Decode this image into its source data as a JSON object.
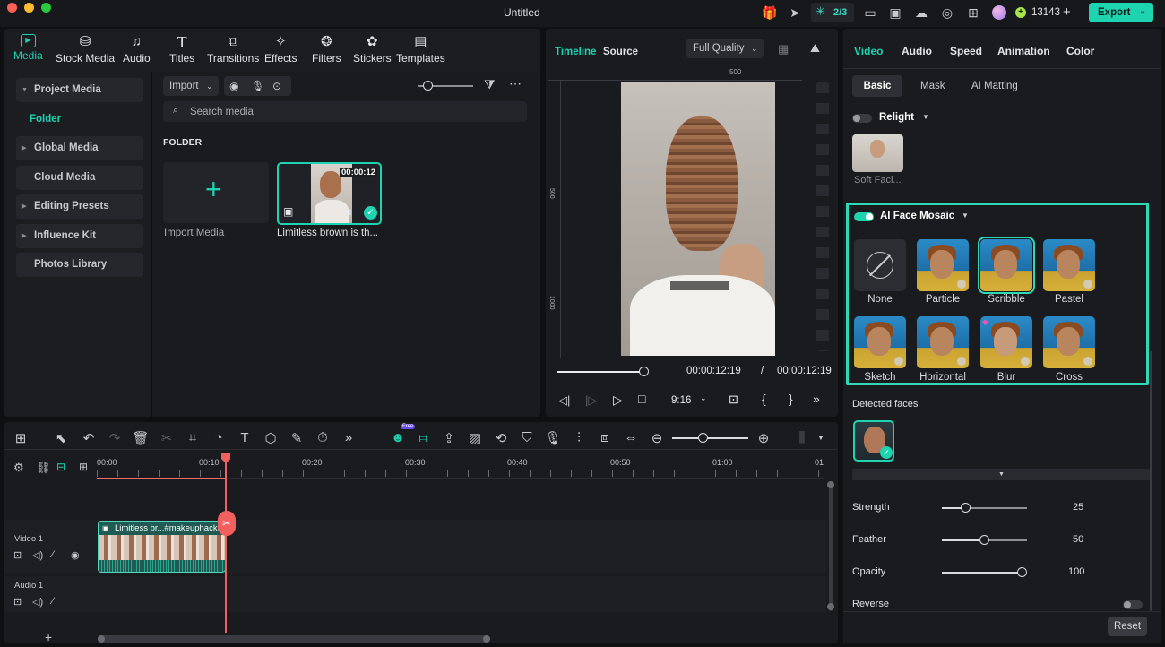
{
  "window": {
    "title": "Untitled",
    "render_progress": "2/3",
    "credits": "13143",
    "export_label": "Export"
  },
  "toolbar": [
    {
      "label": "Media",
      "icon": "media-icon"
    },
    {
      "label": "Stock Media",
      "icon": "stock-media-icon"
    },
    {
      "label": "Audio",
      "icon": "audio-icon"
    },
    {
      "label": "Titles",
      "icon": "titles-icon"
    },
    {
      "label": "Transitions",
      "icon": "transitions-icon"
    },
    {
      "label": "Effects",
      "icon": "effects-icon"
    },
    {
      "label": "Filters",
      "icon": "filters-icon"
    },
    {
      "label": "Stickers",
      "icon": "stickers-icon"
    },
    {
      "label": "Templates",
      "icon": "templates-icon"
    }
  ],
  "sidebar": {
    "items": [
      {
        "label": "Project Media"
      },
      {
        "label": "Folder"
      },
      {
        "label": "Global Media"
      },
      {
        "label": "Cloud Media"
      },
      {
        "label": "Editing Presets"
      },
      {
        "label": "Influence Kit"
      },
      {
        "label": "Photos Library"
      }
    ]
  },
  "media": {
    "import_label": "Import",
    "search_placeholder": "Search media",
    "folder_heading": "FOLDER",
    "import_tile_label": "Import Media",
    "clip": {
      "name": "Limitless brown is th...",
      "duration": "00:00:12"
    }
  },
  "player": {
    "tab_timeline": "Timeline",
    "tab_source": "Source",
    "quality": "Full Quality",
    "ruler_top": "500",
    "ruler_side_1": "500",
    "ruler_side_2": "1000",
    "current_time": "00:00:12:19",
    "separator": "/",
    "total_time": "00:00:12:19",
    "aspect": "9:16",
    "bracket_in": "{",
    "bracket_out": "}",
    "playhead_progress": 1.0
  },
  "inspector": {
    "tabs": [
      "Video",
      "Audio",
      "Speed",
      "Animation",
      "Color"
    ],
    "subtabs": [
      "Basic",
      "Mask",
      "AI Matting"
    ],
    "relight_label": "Relight",
    "soft_face_label": "Soft Faci...",
    "mosaic_title": "AI Face Mosaic",
    "effects": [
      "None",
      "Particle",
      "Scribble",
      "Pastel",
      "Sketch",
      "Horizontal",
      "Blur",
      "Cross"
    ],
    "selected_effect": "Scribble",
    "detected_faces_label": "Detected faces",
    "strength_label": "Strength",
    "strength_value": "25",
    "feather_label": "Feather",
    "feather_value": "50",
    "opacity_label": "Opacity",
    "opacity_value": "100",
    "reverse_label": "Reverse",
    "reset_label": "Reset"
  },
  "timeline": {
    "ruler": [
      "00:00",
      "00:10",
      "00:20",
      "00:30",
      "00:40",
      "00:50",
      "01:00",
      "01"
    ],
    "video_track_label": "Video 1",
    "audio_track_label": "Audio 1",
    "clip_title": "Limitless br...#makeuphacks",
    "free_badge": "Free",
    "add_track": "+"
  }
}
